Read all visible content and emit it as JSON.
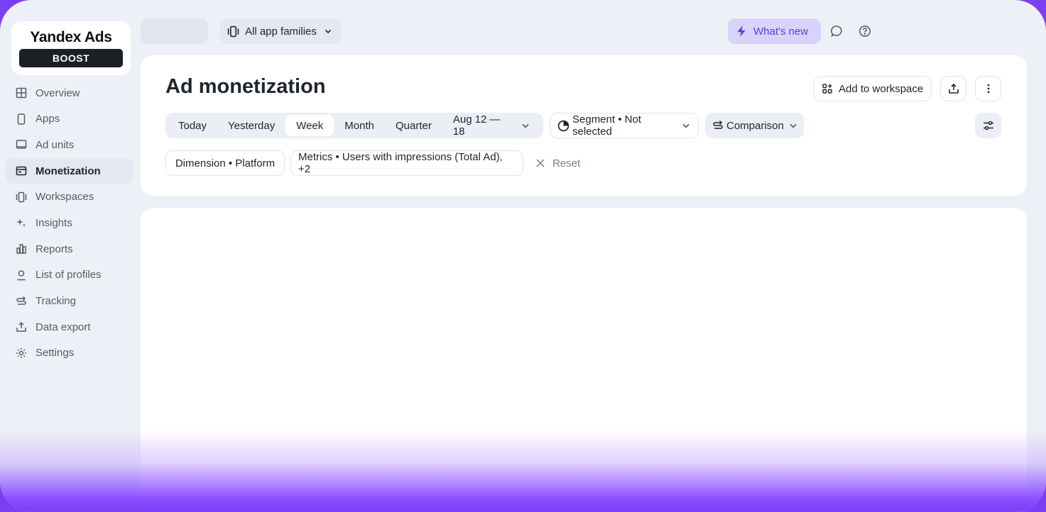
{
  "logo": {
    "title": "Yandex Ads",
    "badge": "BOOST"
  },
  "sidebar": {
    "items": [
      {
        "label": "Overview",
        "icon": "grid-icon"
      },
      {
        "label": "Apps",
        "icon": "phone-icon"
      },
      {
        "label": "Ad units",
        "icon": "ad-unit-icon"
      },
      {
        "label": "Monetization",
        "icon": "monetization-icon",
        "active": true
      },
      {
        "label": "Workspaces",
        "icon": "workspaces-icon"
      },
      {
        "label": "Insights",
        "icon": "sparkle-icon"
      },
      {
        "label": "Reports",
        "icon": "bar-chart-icon"
      },
      {
        "label": "List of profiles",
        "icon": "user-icon"
      },
      {
        "label": "Tracking",
        "icon": "tracking-icon"
      },
      {
        "label": "Data export",
        "icon": "export-icon"
      },
      {
        "label": "Settings",
        "icon": "gear-icon"
      }
    ]
  },
  "topbar": {
    "family_select": "All app families",
    "whats_new": "What's new"
  },
  "page": {
    "title": "Ad monetization",
    "add_to_workspace": "Add to workspace"
  },
  "period": {
    "today": "Today",
    "yesterday": "Yesterday",
    "week": "Week",
    "month": "Month",
    "quarter": "Quarter",
    "range": "Aug 12 — 18",
    "selected": "Week"
  },
  "filters": {
    "segment": "Segment • Not selected",
    "comparison": "Comparison",
    "dimension": "Dimension • Platform",
    "metrics": "Metrics • Users with impressions (Total Ad), +2",
    "reset": "Reset"
  },
  "colors": {
    "accent": "#5b3fd8",
    "accent_bg": "#d9d2fb",
    "frame_bg": "#eef0f7",
    "outer_gradient": "#7b3ff2"
  }
}
